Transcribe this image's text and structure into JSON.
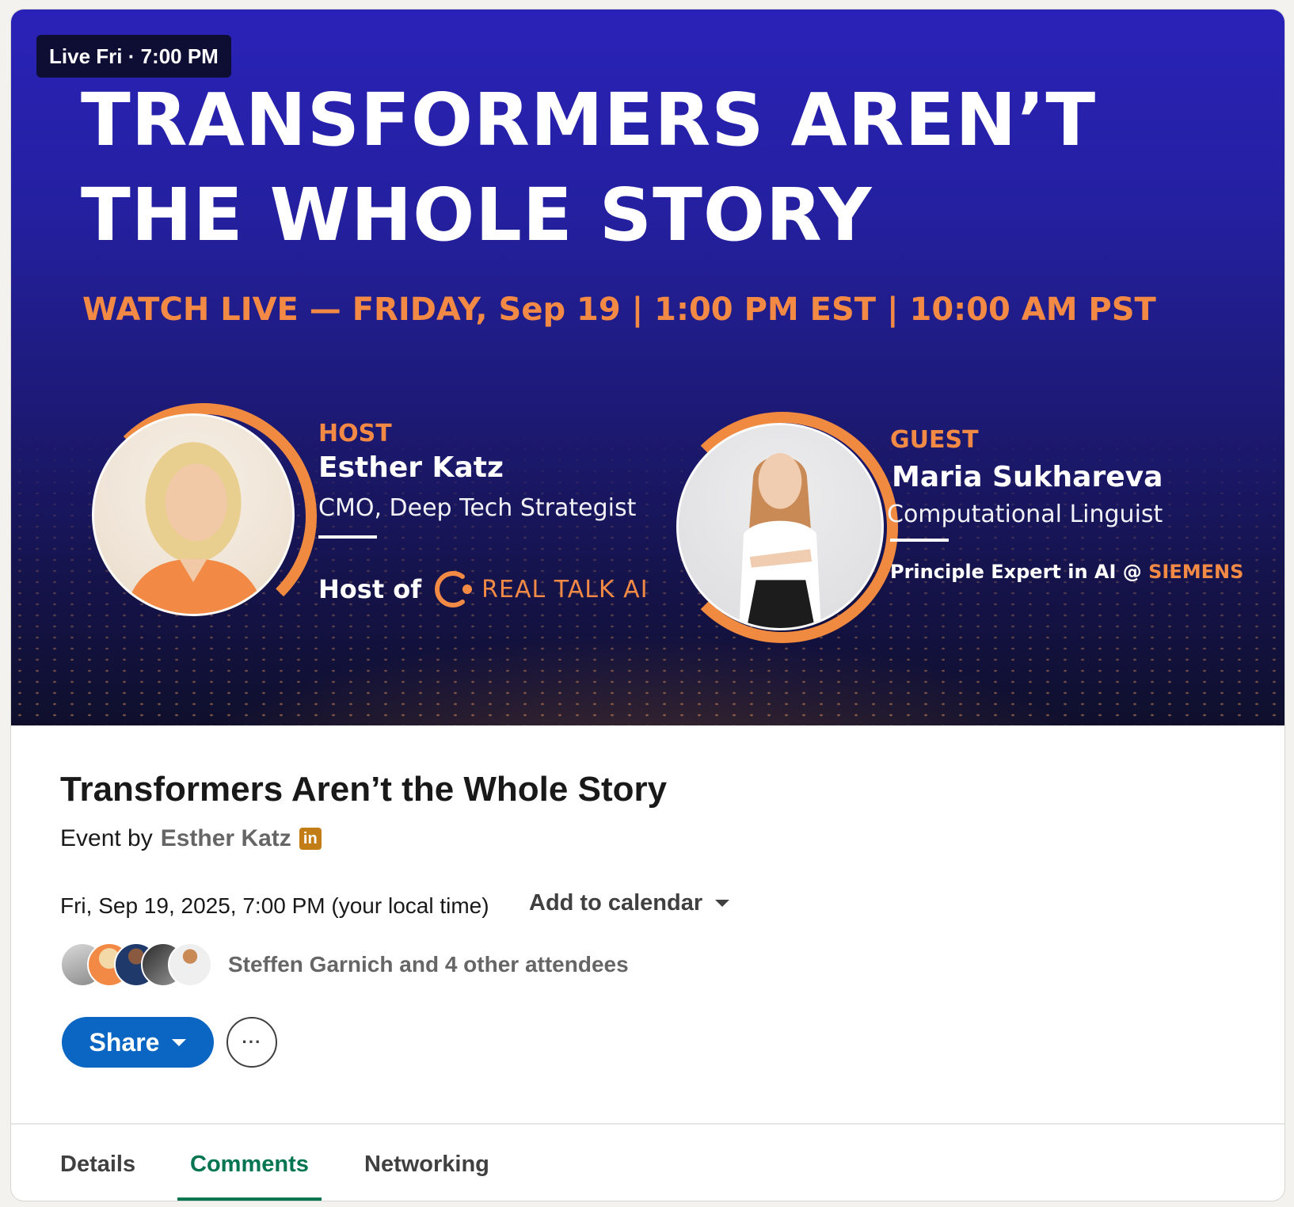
{
  "banner": {
    "live_badge": "Live Fri · 7:00 PM",
    "headline_line1": "TRANSFORMERS AREN’T",
    "headline_line2": "THE WHOLE STORY",
    "watch_line": "WATCH LIVE — FRIDAY, Sep 19 | 1:00 PM EST | 10:00 AM PST",
    "host": {
      "role": "HOST",
      "name": "Esther Katz",
      "title": "CMO, Deep Tech Strategist",
      "host_of_label": "Host of",
      "show_name": "REAL TALK AI"
    },
    "guest": {
      "role": "GUEST",
      "name": "Maria Sukhareva",
      "title": "Computational Linguist",
      "expertise": "Principle Expert in AI @",
      "company": "SIEMENS"
    },
    "colors": {
      "accent_orange": "#f28a45",
      "bg_top": "#2a22b8",
      "bg_bottom": "#0f0f2c"
    }
  },
  "event": {
    "title": "Transformers Aren’t the Whole Story",
    "by_label": "Event by",
    "organizer": "Esther Katz",
    "organizer_badge_icon": "linkedin-icon",
    "organizer_badge_text": "in",
    "datetime": "Fri, Sep 19, 2025, 7:00 PM (your local time)",
    "add_to_calendar": "Add to calendar",
    "attendees_text": "Steffen Garnich and 4 other attendees",
    "attendee_avatar_count": 5
  },
  "actions": {
    "share_label": "Share",
    "more_icon": "ellipsis-icon",
    "more_label": "···",
    "primary_color": "#0a66c2"
  },
  "tabs": [
    {
      "label": "Details",
      "active": false
    },
    {
      "label": "Comments",
      "active": true
    },
    {
      "label": "Networking",
      "active": false
    }
  ]
}
